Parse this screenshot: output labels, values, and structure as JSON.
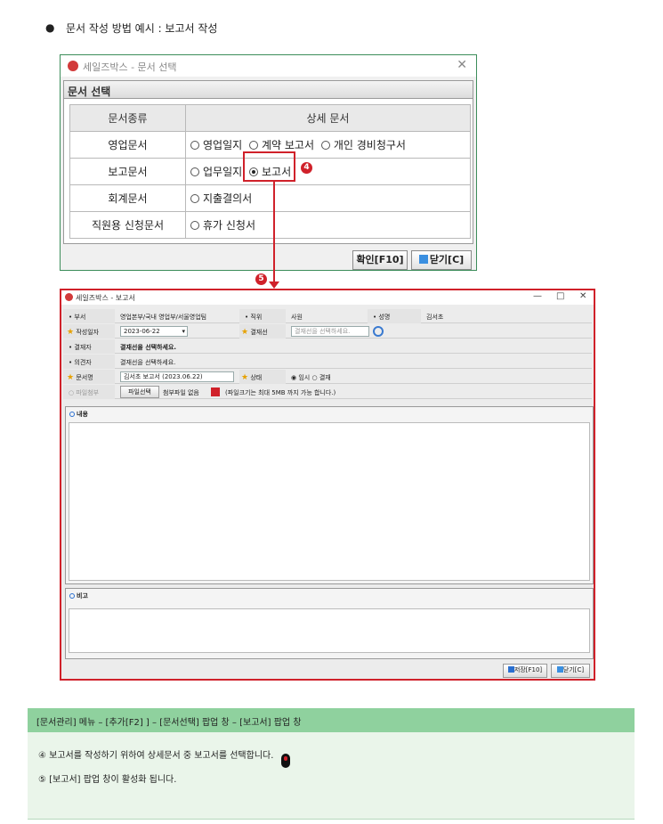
{
  "intro": {
    "bullet": "●",
    "title": "문서 작성 방법 예시 :  보고서 작성"
  },
  "dialog1": {
    "title": "세일즈박스 - 문서 선택",
    "close": "✕",
    "section": "문서 선택",
    "headers": [
      "문서종류",
      "상세 문서"
    ],
    "rows": [
      {
        "category": "영업문서",
        "options": [
          "영업일지",
          "계약 보고서",
          "개인 경비청구서"
        ]
      },
      {
        "category": "보고문서",
        "options": [
          "업무일지",
          "보고서"
        ],
        "selected": "보고서"
      },
      {
        "category": "회계문서",
        "options": [
          "지출결의서"
        ]
      },
      {
        "category": "직원용 신청문서",
        "options": [
          "휴가 신청서"
        ]
      }
    ],
    "badge": "4",
    "confirm": "확인[F10]",
    "close_btn": "닫기[C]"
  },
  "step5_badge": "5",
  "dialog2": {
    "title": "세일즈박스 - 보고서",
    "win_min": "—",
    "win_max": "□",
    "win_close": "✕",
    "dept_label": "부서",
    "dept_value": "영업본부/국내 영업부/서울영업팀",
    "position_label": "직위",
    "position_value": "사원",
    "name_label": "성명",
    "name_value": "김서초",
    "date_label": "작성일자",
    "date_value": "2023-06-22",
    "approval_label": "결재선",
    "approval_placeholder": "결재선을 선택하세요.",
    "approver_label": "결재자",
    "approver_value": "결재선을 선택하세요.",
    "reviewer_label": "의견자",
    "reviewer_value": "결재선을 선택하세요.",
    "docname_label": "문서명",
    "docname_value": "김서초 보고서 (2023.06.22)",
    "status_label": "상태",
    "status_temp": "임시",
    "status_approval": "결재",
    "attach_label": "파일첨부",
    "attach_btn": "파일선택",
    "attach_none": "첨부파일 없음",
    "attach_note": "(파일크기는 최대 5MB 까지 가능 합니다.)",
    "content_label": "내용",
    "remark_label": "비고",
    "save_btn": "저장[F10]",
    "close_btn": "닫기[C]"
  },
  "note": {
    "header": "[문서관리] 메뉴 – [추가[F2] ] – [문서선택] 팝업 창 – [보고서] 팝업 창",
    "line1": "④  보고서를 작성하기 위하여 상세문서 중 보고서를 선택합니다.",
    "line2": "⑤  [보고서]  팝업 창이 활성화 됩니다."
  }
}
